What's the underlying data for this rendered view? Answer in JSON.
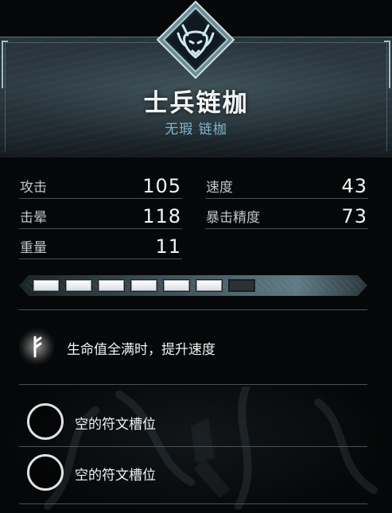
{
  "item": {
    "name": "士兵链枷",
    "subtitle": "无瑕 链枷",
    "emblem_icon": "wolf-head-icon"
  },
  "stats": [
    {
      "label": "攻击",
      "value": "105"
    },
    {
      "label": "速度",
      "value": "43"
    },
    {
      "label": "击晕",
      "value": "118"
    },
    {
      "label": "暴击精度",
      "value": "73"
    },
    {
      "label": "重量",
      "value": "11"
    }
  ],
  "upgrade": {
    "filled": 6,
    "total": 7
  },
  "perk": {
    "icon": "rune-glyph-icon",
    "text": "生命值全满时，提升速度"
  },
  "rune_slots": [
    {
      "label": "空的符文槽位",
      "icon": "empty-slot-icon"
    },
    {
      "label": "空的符文槽位",
      "icon": "empty-slot-icon"
    }
  ],
  "colors": {
    "subtitle": "#7fb6c8",
    "accent_frame": "#9fc0c8",
    "segment_on": "#ffffff",
    "segment_off": "#2c3134"
  }
}
